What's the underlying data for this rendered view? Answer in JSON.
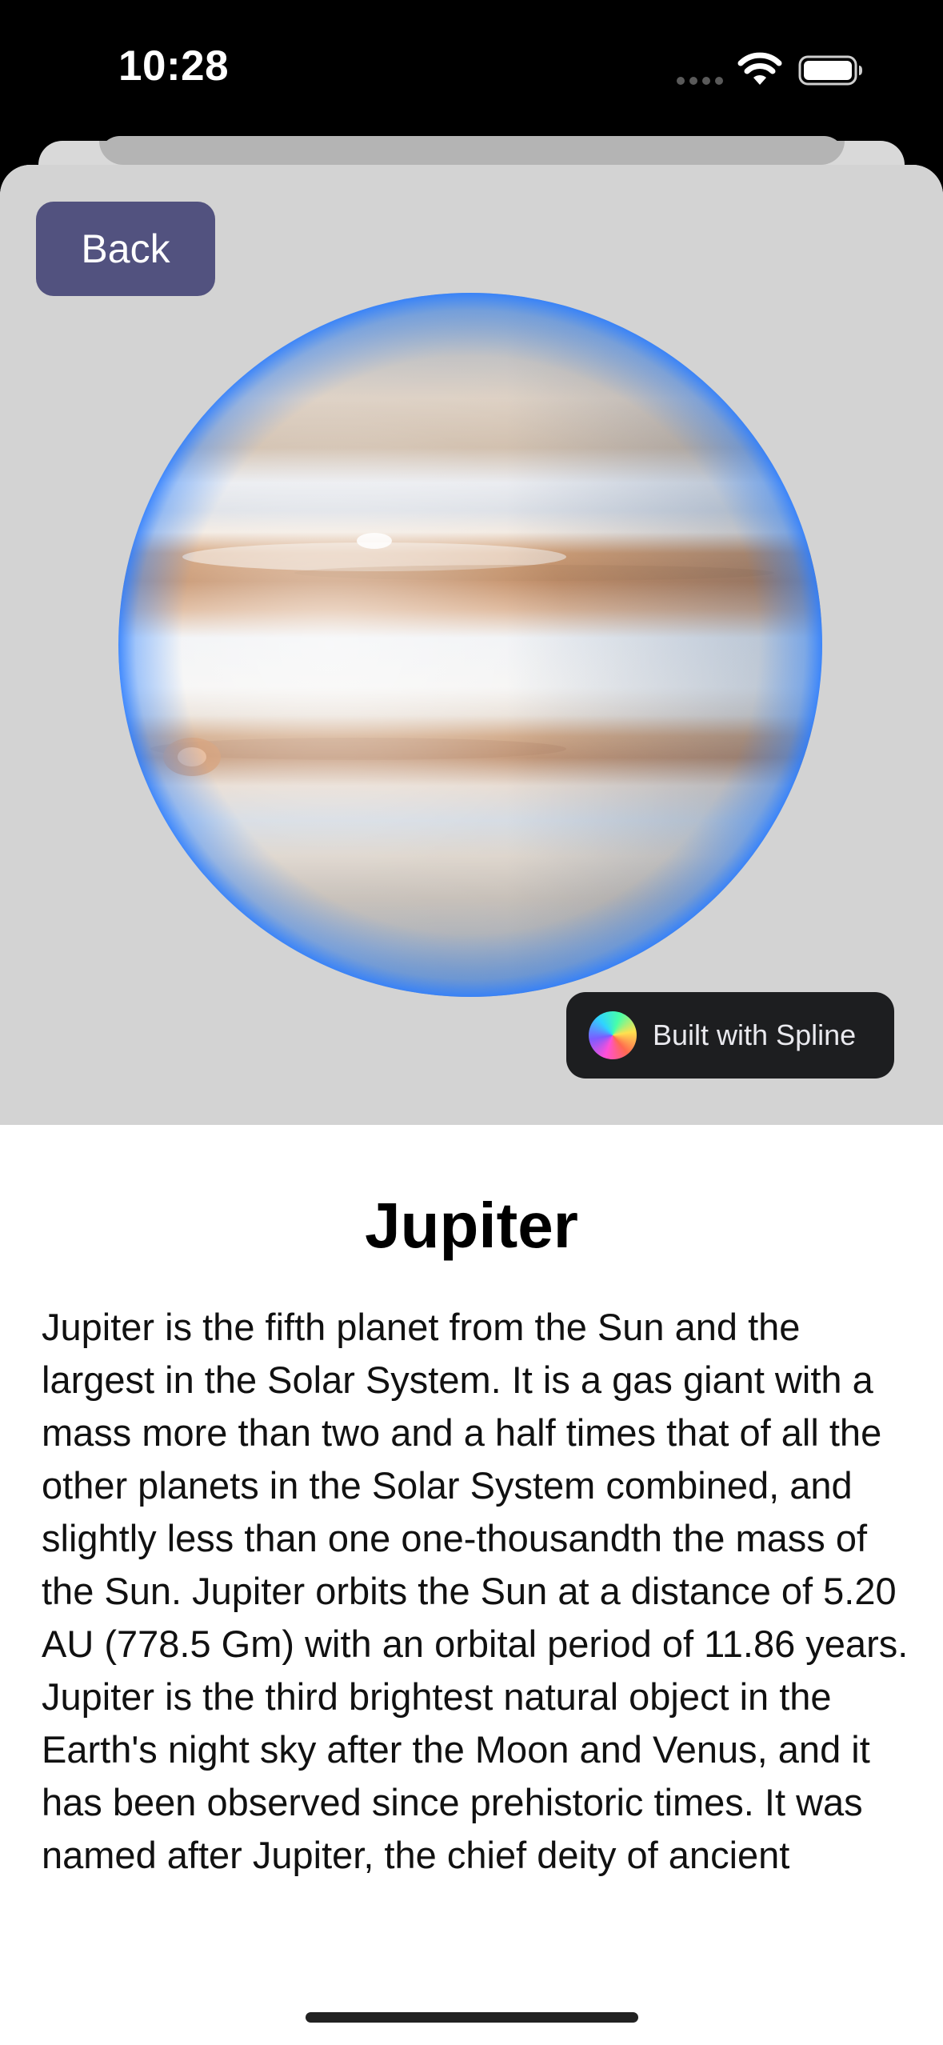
{
  "status_bar": {
    "time": "10:28"
  },
  "scene": {
    "back_label": "Back",
    "badge_label": "Built with Spline",
    "planet_icon": "jupiter-planet-3d-render"
  },
  "content": {
    "title": "Jupiter",
    "description": "Jupiter is the fifth planet from the Sun and the largest in the Solar System. It is a gas giant with a mass more than two and a half times that of all the other planets in the Solar System combined, and slightly less than one one-thousandth the mass of the Sun. Jupiter orbits the Sun at a distance of 5.20 AU (778.5 Gm) with an orbital period of 11.86 years. Jupiter is the third brightest natural object in the Earth's night sky after the Moon and Venus, and it has been observed since prehistoric times. It was named after Jupiter, the chief deity of ancient"
  },
  "colors": {
    "back_button": "#52527f",
    "scene_background": "#d3d3d3",
    "badge_background": "#1d1e20"
  }
}
